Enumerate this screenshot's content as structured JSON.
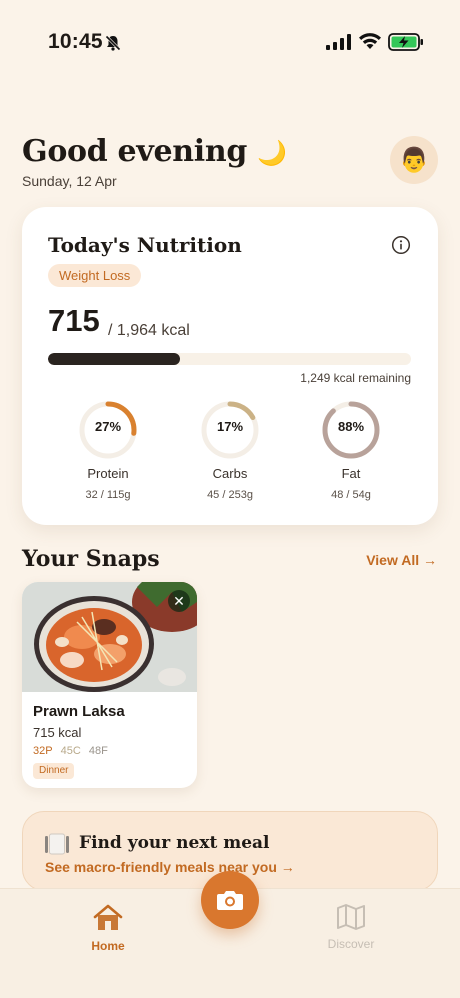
{
  "status_bar": {
    "time": "10:45"
  },
  "header": {
    "greeting": "Good evening",
    "greeting_emoji": "🌙",
    "date": "Sunday, 12 Apr",
    "avatar_emoji": "👨"
  },
  "nutrition": {
    "title": "Today's Nutrition",
    "goal_badge": "Weight Loss",
    "consumed": "715",
    "target_text": "/ 1,964 kcal",
    "progress_fraction": 0.364,
    "remaining_text": "1,249 kcal remaining",
    "macros": [
      {
        "name": "Protein",
        "percent_text": "27%",
        "fraction": 0.27,
        "amount": "32 / 115g",
        "color": "#d9812f"
      },
      {
        "name": "Carbs",
        "percent_text": "17%",
        "fraction": 0.17,
        "amount": "45 / 253g",
        "color": "#cbb286"
      },
      {
        "name": "Fat",
        "percent_text": "88%",
        "fraction": 0.88,
        "amount": "48 / 54g",
        "color": "#b8a29a"
      }
    ]
  },
  "snaps": {
    "title": "Your Snaps",
    "view_all": "View All →",
    "items": [
      {
        "name": "Prawn Laksa",
        "kcal": "715 kcal",
        "protein": "32P",
        "carbs": "45C",
        "fat": "48F",
        "meal": "Dinner"
      }
    ]
  },
  "banner": {
    "title": "Find your next meal",
    "subtitle": "See macro-friendly meals near you →"
  },
  "tabbar": {
    "home": "Home",
    "discover": "Discover"
  },
  "colors": {
    "accent": "#c26a22",
    "background": "#fbf3e9",
    "camera_button": "#d9772e"
  }
}
